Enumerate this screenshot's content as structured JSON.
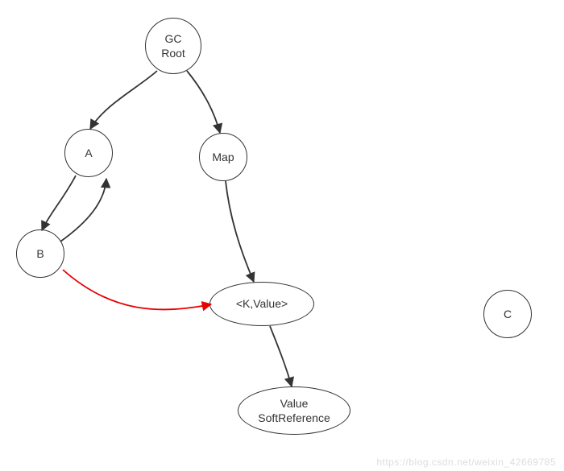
{
  "nodes": {
    "gc_root": {
      "label": "GC\nRoot"
    },
    "a": {
      "label": "A"
    },
    "b": {
      "label": "B"
    },
    "map": {
      "label": "Map"
    },
    "kvalue": {
      "label": "<K,Value>"
    },
    "value_softref": {
      "label": "Value\nSoftReference"
    },
    "c": {
      "label": "C"
    }
  },
  "edges": [
    {
      "from": "gc_root",
      "to": "a",
      "color": "#333"
    },
    {
      "from": "gc_root",
      "to": "map",
      "color": "#333"
    },
    {
      "from": "a",
      "to": "b",
      "color": "#333"
    },
    {
      "from": "b",
      "to": "a",
      "color": "#333"
    },
    {
      "from": "b",
      "to": "kvalue",
      "color": "#e60000"
    },
    {
      "from": "map",
      "to": "kvalue",
      "color": "#333"
    },
    {
      "from": "kvalue",
      "to": "value_softref",
      "color": "#333"
    }
  ],
  "watermark": "https://blog.csdn.net/weixin_42669785",
  "chart_data": {
    "type": "diagram",
    "title": "",
    "nodes": [
      {
        "id": "gc_root",
        "label": "GC Root"
      },
      {
        "id": "a",
        "label": "A"
      },
      {
        "id": "b",
        "label": "B"
      },
      {
        "id": "map",
        "label": "Map"
      },
      {
        "id": "kvalue",
        "label": "<K,Value>"
      },
      {
        "id": "value_softref",
        "label": "Value SoftReference"
      },
      {
        "id": "c",
        "label": "C"
      }
    ],
    "edges": [
      {
        "from": "gc_root",
        "to": "a",
        "style": "normal"
      },
      {
        "from": "gc_root",
        "to": "map",
        "style": "normal"
      },
      {
        "from": "a",
        "to": "b",
        "style": "normal"
      },
      {
        "from": "b",
        "to": "a",
        "style": "normal"
      },
      {
        "from": "b",
        "to": "kvalue",
        "style": "highlighted-red"
      },
      {
        "from": "map",
        "to": "kvalue",
        "style": "normal"
      },
      {
        "from": "kvalue",
        "to": "value_softref",
        "style": "normal"
      }
    ]
  }
}
